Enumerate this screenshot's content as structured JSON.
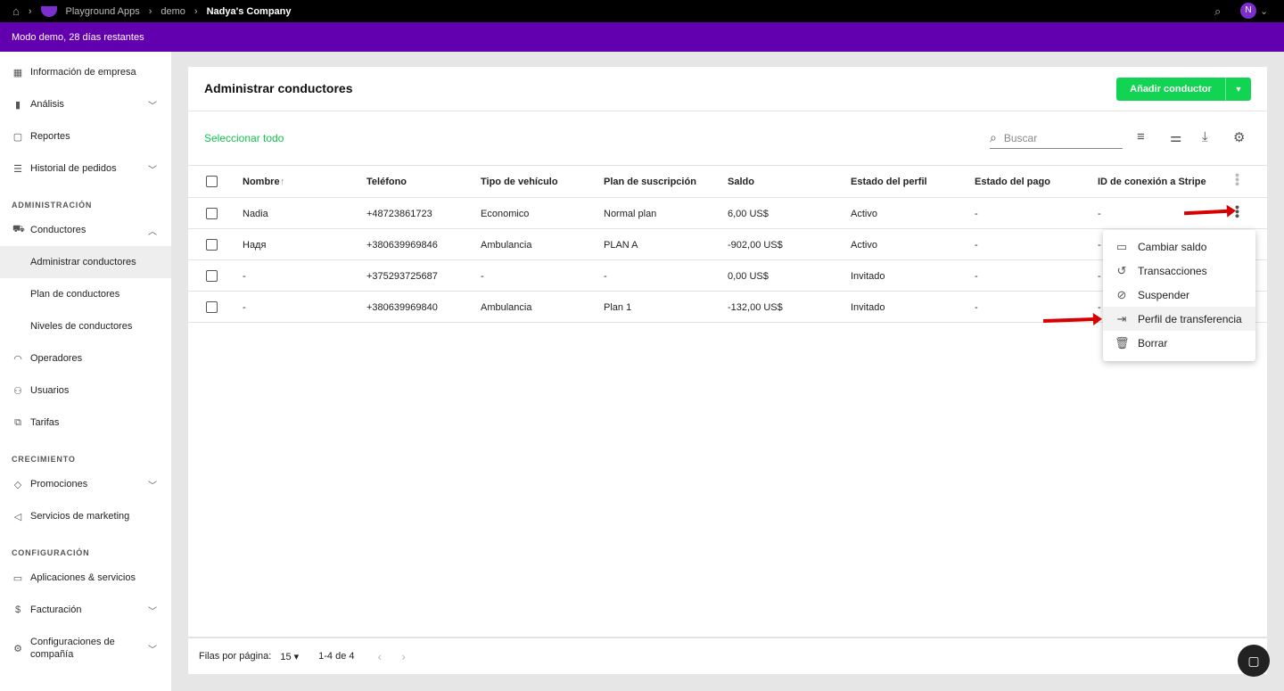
{
  "topbar": {
    "breadcrumbs": [
      "Playground Apps",
      "demo",
      "Nadya's Company"
    ],
    "avatar": "N"
  },
  "banner": "Modo demo, 28 días restantes",
  "sidebar": {
    "items": [
      {
        "label": "Información de empresa",
        "icon": "dashboard-icon"
      },
      {
        "label": "Análisis",
        "icon": "bar-chart-icon",
        "chevron": "down"
      },
      {
        "label": "Reportes",
        "icon": "document-icon"
      },
      {
        "label": "Historial de pedidos",
        "icon": "list-icon",
        "chevron": "down"
      }
    ],
    "sec_admin": "ADMINISTRACIÓN",
    "admin": [
      {
        "label": "Conductores",
        "icon": "car-icon",
        "chevron": "up"
      },
      {
        "label": "Administrar conductores",
        "sub": true,
        "selected": true
      },
      {
        "label": "Plan de conductores",
        "sub": true
      },
      {
        "label": "Niveles de conductores",
        "sub": true
      },
      {
        "label": "Operadores",
        "icon": "headset-icon"
      },
      {
        "label": "Usuarios",
        "icon": "users-icon"
      },
      {
        "label": "Tarifas",
        "icon": "tariff-icon"
      }
    ],
    "sec_growth": "CRECIMIENTO",
    "growth": [
      {
        "label": "Promociones",
        "icon": "tag-icon",
        "chevron": "down"
      },
      {
        "label": "Servicios de marketing",
        "icon": "megaphone-icon"
      }
    ],
    "sec_config": "CONFIGURACIÓN",
    "config": [
      {
        "label": "Aplicaciones & servicios",
        "icon": "devices-icon"
      },
      {
        "label": "Facturación",
        "icon": "billing-icon",
        "chevron": "down"
      },
      {
        "label": "Configuraciones de compañía",
        "icon": "gear-icon",
        "chevron": "down"
      }
    ]
  },
  "main": {
    "title": "Administrar conductores",
    "add_button": "Añadir conductor",
    "select_all": "Seleccionar todo",
    "search_placeholder": "Buscar",
    "columns": [
      "Nombre",
      "Teléfono",
      "Tipo de vehículo",
      "Plan de suscripción",
      "Saldo",
      "Estado del perfil",
      "Estado del pago",
      "ID de conexión a Stripe"
    ],
    "rows": [
      [
        "Nadia",
        "+48723861723",
        "Economico",
        "Normal plan",
        "6,00 US$",
        "Activo",
        "-",
        "-"
      ],
      [
        "Надя",
        "+380639969846",
        "Ambulancia",
        "PLAN A",
        "-902,00 US$",
        "Activo",
        "-",
        "-"
      ],
      [
        "-",
        "+375293725687",
        "-",
        "-",
        "0,00 US$",
        "Invitado",
        "-",
        "-"
      ],
      [
        "-",
        "+380639969840",
        "Ambulancia",
        "Plan 1",
        "-132,00 US$",
        "Invitado",
        "-",
        "-"
      ]
    ],
    "menu": [
      {
        "label": "Cambiar saldo",
        "icon": "card-icon"
      },
      {
        "label": "Transacciones",
        "icon": "history-icon"
      },
      {
        "label": "Suspender",
        "icon": "eye-off-icon"
      },
      {
        "label": "Perfil de transferencia",
        "icon": "transfer-icon"
      },
      {
        "label": "Borrar",
        "icon": "trash-icon"
      }
    ],
    "footer": {
      "rows_label": "Filas por página:",
      "rows_value": "15",
      "range": "1-4 de 4"
    }
  }
}
